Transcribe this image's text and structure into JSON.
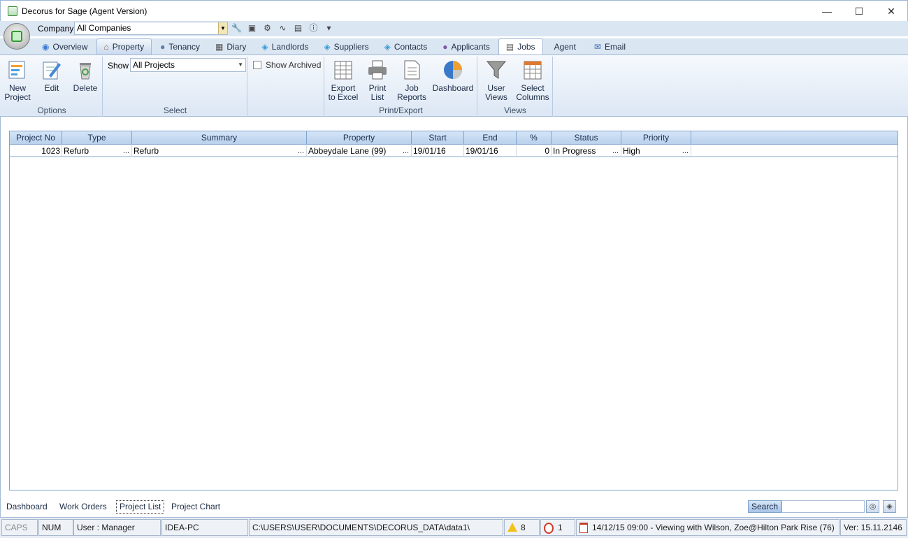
{
  "window": {
    "title": "Decorus for Sage (Agent Version)"
  },
  "company": {
    "label": "Company",
    "value": "All Companies"
  },
  "tabs": [
    {
      "label": "Overview",
      "icon": "overview-icon"
    },
    {
      "label": "Property",
      "icon": "house-icon"
    },
    {
      "label": "Tenancy",
      "icon": "people-icon"
    },
    {
      "label": "Diary",
      "icon": "calendar-icon"
    },
    {
      "label": "Landlords",
      "icon": "landlord-icon"
    },
    {
      "label": "Suppliers",
      "icon": "supplier-icon"
    },
    {
      "label": "Contacts",
      "icon": "contacts-icon"
    },
    {
      "label": "Applicants",
      "icon": "applicants-icon"
    },
    {
      "label": "Jobs",
      "icon": "jobs-icon"
    },
    {
      "label": "Agent",
      "icon": ""
    },
    {
      "label": "Email",
      "icon": "email-icon"
    }
  ],
  "ribbon": {
    "options": {
      "label": "Options",
      "new_project": [
        "New",
        "Project"
      ],
      "edit": "Edit",
      "delete": "Delete"
    },
    "select": {
      "label": "Select",
      "show_label": "Show",
      "show_value": "All Projects",
      "show_archived": "Show Archived"
    },
    "print_export": {
      "label": "Print/Export",
      "export_excel": [
        "Export",
        "to Excel"
      ],
      "print_list": [
        "Print",
        "List"
      ],
      "job_reports": [
        "Job",
        "Reports"
      ],
      "dashboard": "Dashboard"
    },
    "views": {
      "label": "Views",
      "user_views": [
        "User",
        "Views"
      ],
      "select_columns": [
        "Select",
        "Columns"
      ]
    }
  },
  "grid": {
    "columns": [
      "Project No",
      "Type",
      "Summary",
      "Property",
      "Start",
      "End",
      "%",
      "Status",
      "Priority"
    ],
    "rows": [
      {
        "project_no": "1023",
        "type": "Refurb",
        "summary": "Refurb",
        "property": "Abbeydale Lane (99)",
        "start": "19/01/16",
        "end": "19/01/16",
        "percent": "0",
        "status": "In Progress",
        "priority": "High"
      }
    ]
  },
  "bottom_tabs": [
    "Dashboard",
    "Work Orders",
    "Project List",
    "Project Chart"
  ],
  "search": {
    "label": "Search",
    "value": ""
  },
  "status": {
    "caps": "CAPS",
    "num": "NUM",
    "user": "User : Manager",
    "pc": "IDEA-PC",
    "path": "C:\\USERS\\USER\\DOCUMENTS\\DECORUS_DATA\\data1\\",
    "warnings": "8",
    "alarms": "1",
    "next_appointment": "14/12/15 09:00 - Viewing with Wilson, Zoe@Hilton Park Rise (76)",
    "version": "Ver: 15.11.2146"
  }
}
